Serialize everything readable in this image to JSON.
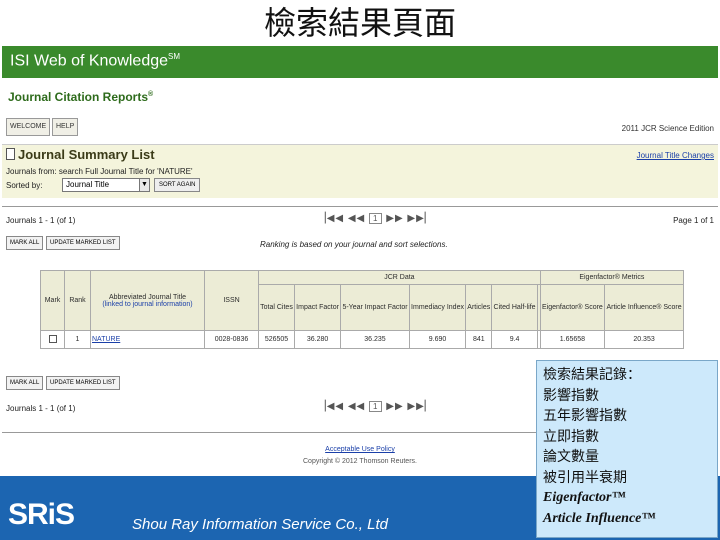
{
  "slide": {
    "title": "檢索結果頁面"
  },
  "isi": {
    "logo_text": "ISI Web of Knowledge",
    "logo_sup": "SM"
  },
  "jcr": {
    "logo_text": "Journal Citation Reports",
    "logo_sup": "®"
  },
  "toolbar": {
    "welcome_label": "WELCOME",
    "help_label": "HELP",
    "edition": "2011 JCR Science Edition"
  },
  "summary": {
    "title": "Journal Summary List",
    "title_changes_link": "Journal Title Changes",
    "journals_from": "Journals from:  search Full Journal Title for 'NATURE'",
    "sorted_by_label": "Sorted by:",
    "sort_value": "Journal Title",
    "sort_again_label": "SORT AGAIN"
  },
  "results": {
    "count_top": "Journals 1 - 1 (of 1)",
    "count_bottom": "Journals 1 - 1 (of 1)",
    "pager_page": "1",
    "page_of": "Page 1 of 1",
    "mark_all_label": "MARK ALL",
    "update_marked_label": "UPDATE MARKED LIST",
    "ranking_note": "Ranking is based on your journal and sort selections."
  },
  "table": {
    "group_jcr": "JCR Data",
    "group_eigen": "Eigenfactor® Metrics",
    "headers": {
      "mark": "Mark",
      "rank": "Rank",
      "abbrev_title": "Abbreviated Journal Title",
      "abbrev_sub": "(linked to journal information)",
      "issn": "ISSN",
      "total_cites": "Total Cites",
      "impact_factor": "Impact Factor",
      "five_year": "5-Year Impact Factor",
      "immediacy": "Immediacy Index",
      "articles": "Articles",
      "half_life": "Cited Half-life",
      "eigen_score": "Eigenfactor® Score",
      "ai_score": "Article Influence® Score"
    },
    "rows": [
      {
        "rank": "1",
        "title": "NATURE",
        "issn": "0028-0836",
        "total_cites": "526505",
        "impact_factor": "36.280",
        "five_year": "36.235",
        "immediacy": "9.690",
        "articles": "841",
        "half_life": "9.4",
        "eigen_score": "1.65658",
        "ai_score": "20.353"
      }
    ]
  },
  "footer": {
    "policy_link": "Acceptable Use Policy",
    "copyright": "Copyright © 2012 Thomson Reuters."
  },
  "overlay": {
    "lines": [
      "檢索結果記錄：",
      "影響指數",
      "五年影響指數",
      "立即指數",
      "論文數量",
      "被引用半衰期"
    ],
    "eigen_line": "Eigenfactor™",
    "ai_line": "Article Influence™"
  },
  "branding": {
    "logo": "SRiS",
    "company": "Shou Ray Information Service Co., Ltd"
  }
}
